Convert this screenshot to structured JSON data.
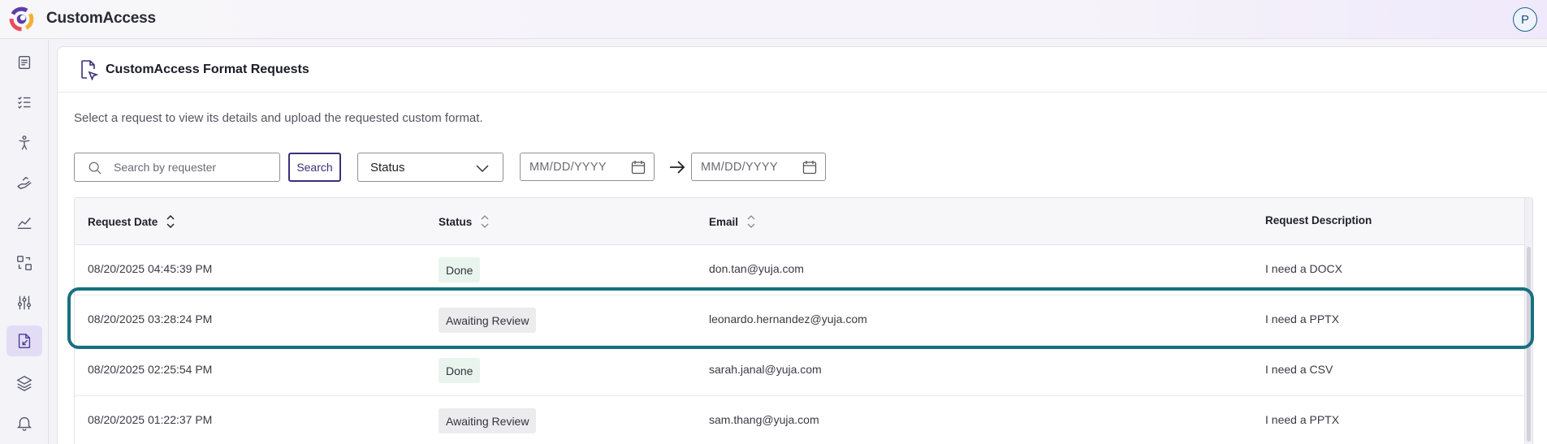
{
  "app": {
    "title": "CustomAccess",
    "avatar_initial": "P"
  },
  "sidebar": {
    "items": [
      {
        "icon": "document-icon"
      },
      {
        "icon": "checklist-icon"
      },
      {
        "icon": "accessibility-icon"
      },
      {
        "icon": "hand-icon"
      },
      {
        "icon": "analytics-icon"
      },
      {
        "icon": "scan-icon"
      },
      {
        "icon": "sliders-icon"
      },
      {
        "icon": "format-request-icon",
        "active": true
      },
      {
        "icon": "layers-icon"
      },
      {
        "icon": "bell-icon"
      }
    ]
  },
  "page": {
    "title": "CustomAccess Format Requests",
    "intro": "Select a request to view its details and upload the requested custom format."
  },
  "filters": {
    "search_placeholder": "Search by requester",
    "search_button": "Search",
    "status_label": "Status",
    "date_from_placeholder": "MM/DD/YYYY",
    "date_to_placeholder": "MM/DD/YYYY"
  },
  "table": {
    "columns": [
      "Request Date",
      "Status",
      "Email",
      "Request Description"
    ],
    "rows": [
      {
        "date": "08/20/2025 04:45:39 PM",
        "status": "Done",
        "email": "don.tan@yuja.com",
        "description": "I need a DOCX"
      },
      {
        "date": "08/20/2025 03:28:24 PM",
        "status": "Awaiting Review",
        "email": "leonardo.hernandez@yuja.com",
        "description": "I need a PPTX",
        "highlighted": true
      },
      {
        "date": "08/20/2025 02:25:54 PM",
        "status": "Done",
        "email": "sarah.janal@yuja.com",
        "description": "I need a CSV"
      },
      {
        "date": "08/20/2025 01:22:37 PM",
        "status": "Awaiting Review",
        "email": "sam.thang@yuja.com",
        "description": "I need a PPTX"
      }
    ]
  },
  "colors": {
    "accent": "#3b2f7a",
    "highlight_ring": "#17707f",
    "done_badge": "#eaf4ee",
    "awaiting_badge": "#ececef",
    "active_nav": "#e3dcf5"
  }
}
